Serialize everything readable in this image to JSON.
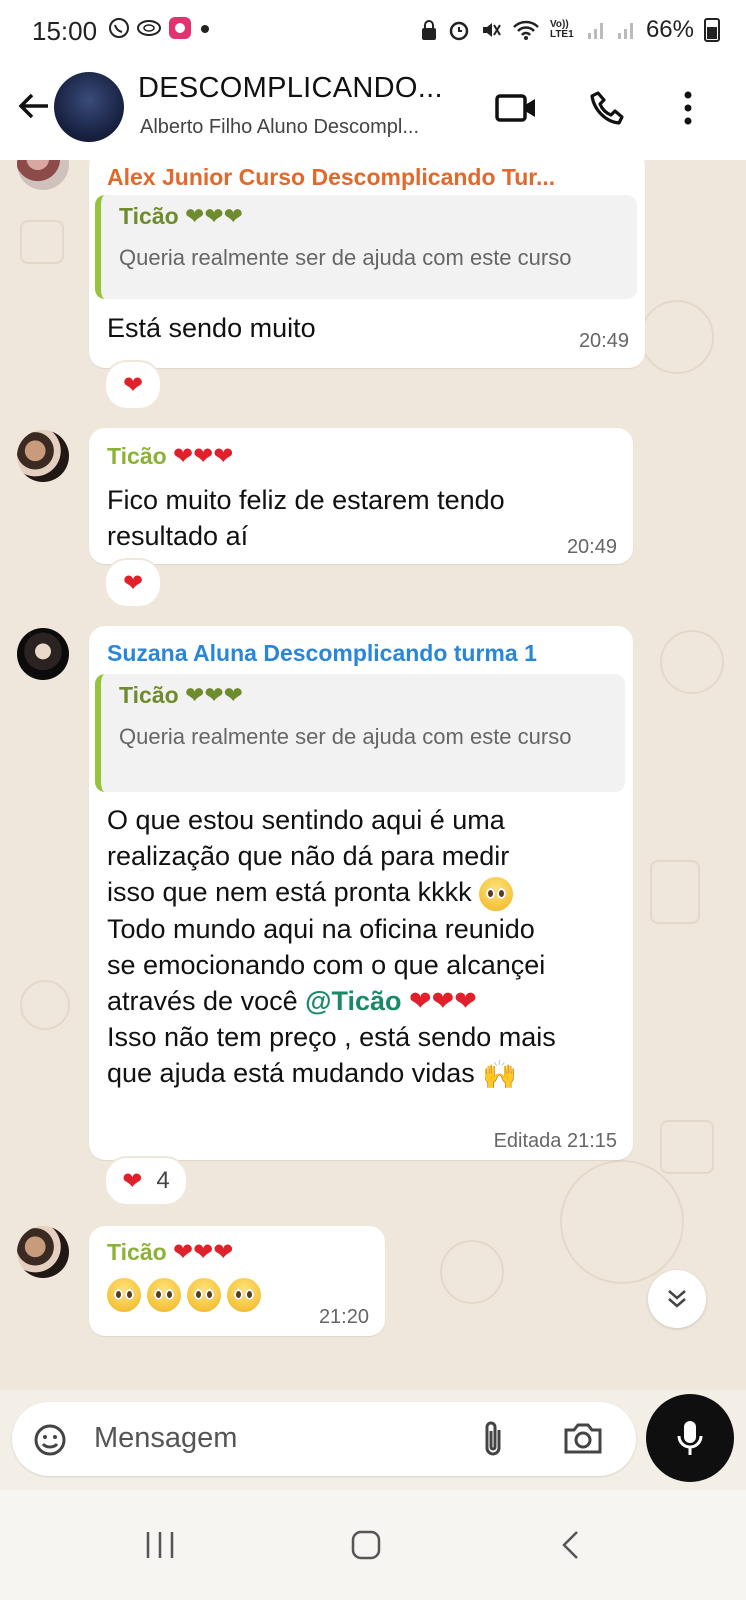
{
  "status_bar": {
    "time": "15:00",
    "left_icons": [
      "whatsapp-icon",
      "vpn-icon",
      "app-icon",
      "dot-icon"
    ],
    "right_icons": [
      "lock-icon",
      "alarm-icon",
      "mute-icon",
      "wifi-icon",
      "volte-icon",
      "signal-icon",
      "signal-icon"
    ],
    "volte_label": "Vo)) LTE1",
    "battery": "66%"
  },
  "header": {
    "title": "DESCOMPLICANDO...",
    "subtitle": "Alberto Filho Aluno Descompl...",
    "icons": [
      "back-arrow-icon",
      "video-call-icon",
      "phone-icon",
      "more-vert-icon"
    ]
  },
  "messages": [
    {
      "sender": "Alex Junior Curso Descomplicando Tur...",
      "sender_color": "#e0692b",
      "quote_author": "Ticão ❤❤❤",
      "quote_text": "Queria realmente ser de ajuda com este curso",
      "text": "Está sendo muito",
      "time": "20:49",
      "reaction": "❤"
    },
    {
      "sender": "Ticão",
      "sender_hearts": "❤❤❤",
      "sender_color": "#8bb236",
      "text_lines": [
        "Fico muito feliz de estarem tendo",
        "resultado aí"
      ],
      "time": "20:49",
      "reaction": "❤"
    },
    {
      "sender": "Suzana Aluna Descomplicando turma 1",
      "sender_color": "#2a86d6",
      "quote_author": "Ticão ❤❤❤",
      "quote_text": "Queria realmente ser de ajuda com este curso",
      "text_lines": [
        "O que estou sentindo aqui é uma",
        "realização que não dá para medir",
        "isso que nem está pronta kkkk",
        "Todo mundo aqui na oficina reunido",
        "se emocionando com o que alcançei",
        "através de você ",
        "Isso não tem preço , está sendo mais",
        "que ajuda está mudando vidas"
      ],
      "mention": "@Ticão",
      "mention_hearts": "❤❤❤",
      "time": "Editada 21:15",
      "reaction": "❤",
      "reaction_count": "4"
    },
    {
      "sender": "Ticão",
      "sender_hearts": "❤❤❤",
      "sender_color": "#8bb236",
      "emoji_count": 4,
      "time": "21:20"
    }
  ],
  "input": {
    "placeholder": "Mensagem",
    "icons": [
      "sticker-icon",
      "attach-icon",
      "camera-icon",
      "mic-icon"
    ]
  },
  "nav": {
    "icons": [
      "recents-icon",
      "home-icon",
      "back-icon"
    ]
  },
  "colors": {
    "chat_bg": "#efe7dc",
    "bubble": "#ffffff",
    "quote_bar": "#97c33c",
    "heart": "#e0202a",
    "mention": "#1a8a63"
  }
}
